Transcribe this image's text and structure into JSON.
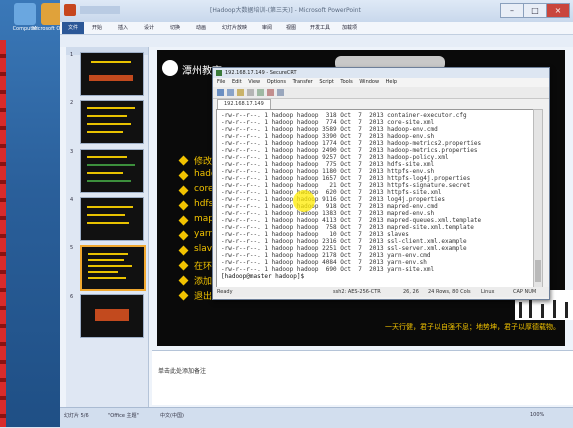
{
  "powerpoint": {
    "title": "[Hadoop大数据培训-(第三天)] - Microsoft PowerPoint",
    "menu": [
      "文件",
      "开始",
      "插入",
      "设计",
      "切换",
      "动画",
      "幻灯片放映",
      "审阅",
      "视图",
      "开发工具",
      "加载项"
    ],
    "notes_placeholder": "单击此处添加备注",
    "status": [
      "幻灯片 5/6",
      "\"Office 主题\"",
      "中文(中国)",
      "100%"
    ]
  },
  "slide": {
    "org_name": "潭州教育",
    "bullets": [
      "修改配置文件",
      "hadoop-env.sh",
      "core-site.xml",
      "hdfs-site.xml",
      "mapred-site.xml",
      "yarn-site.xml",
      "slaves",
      "在环境变量中",
      "添加配置",
      "退出"
    ],
    "footer": "一天行健，君子以自强不息；地势坤，君子以厚德载物。"
  },
  "desktop_icons": [
    {
      "label": "Computer",
      "color": "#6aa7e0"
    },
    {
      "label": "Microsoft Office",
      "color": "#e0a23a"
    }
  ],
  "securecrt": {
    "title": "192.168.17.149 - SecureCRT",
    "menu": [
      "File",
      "Edit",
      "View",
      "Options",
      "Transfer",
      "Script",
      "Tools",
      "Window",
      "Help"
    ],
    "tab": "192.168.17.149",
    "lines": [
      "-rw-r--r--. 1 hadoop hadoop  318 Oct  7  2013 container-executor.cfg",
      "-rw-r--r--. 1 hadoop hadoop  774 Oct  7  2013 core-site.xml",
      "-rw-r--r--. 1 hadoop hadoop 3589 Oct  7  2013 hadoop-env.cmd",
      "-rw-r--r--. 1 hadoop hadoop 3390 Oct  7  2013 hadoop-env.sh",
      "-rw-r--r--. 1 hadoop hadoop 1774 Oct  7  2013 hadoop-metrics2.properties",
      "-rw-r--r--. 1 hadoop hadoop 2490 Oct  7  2013 hadoop-metrics.properties",
      "-rw-r--r--. 1 hadoop hadoop 9257 Oct  7  2013 hadoop-policy.xml",
      "-rw-r--r--. 1 hadoop hadoop  775 Oct  7  2013 hdfs-site.xml",
      "-rw-r--r--. 1 hadoop hadoop 1180 Oct  7  2013 httpfs-env.sh",
      "-rw-r--r--. 1 hadoop hadoop 1657 Oct  7  2013 httpfs-log4j.properties",
      "-rw-r--r--. 1 hadoop hadoop   21 Oct  7  2013 httpfs-signature.secret",
      "-rw-r--r--. 1 hadoop hadoop  620 Oct  7  2013 httpfs-site.xml",
      "-rw-r--r--. 1 hadoop hadoop 9116 Oct  7  2013 log4j.properties",
      "-rw-r--r--. 1 hadoop hadoop  918 Oct  7  2013 mapred-env.cmd",
      "-rw-r--r--. 1 hadoop hadoop 1383 Oct  7  2013 mapred-env.sh",
      "-rw-r--r--. 1 hadoop hadoop 4113 Oct  7  2013 mapred-queues.xml.template",
      "-rw-r--r--. 1 hadoop hadoop  758 Oct  7  2013 mapred-site.xml.template",
      "-rw-r--r--. 1 hadoop hadoop   10 Oct  7  2013 slaves",
      "-rw-r--r--. 1 hadoop hadoop 2316 Oct  7  2013 ssl-client.xml.example",
      "-rw-r--r--. 1 hadoop hadoop 2251 Oct  7  2013 ssl-server.xml.example",
      "-rw-r--r--. 1 hadoop hadoop 2178 Oct  7  2013 yarn-env.cmd",
      "-rw-r--r--. 1 hadoop hadoop 4084 Oct  7  2013 yarn-env.sh",
      "-rw-r--r--. 1 hadoop hadoop  690 Oct  7  2013 yarn-site.xml",
      "[hadoop@master hadoop]$ "
    ],
    "status": [
      "Ready",
      "ssh2: AES-256-CTR",
      "26, 26",
      "24 Rows, 80 Cols",
      "Linux",
      "CAP  NUM"
    ]
  },
  "thumbnails": [
    "1",
    "2",
    "3",
    "4",
    "5",
    "6"
  ]
}
